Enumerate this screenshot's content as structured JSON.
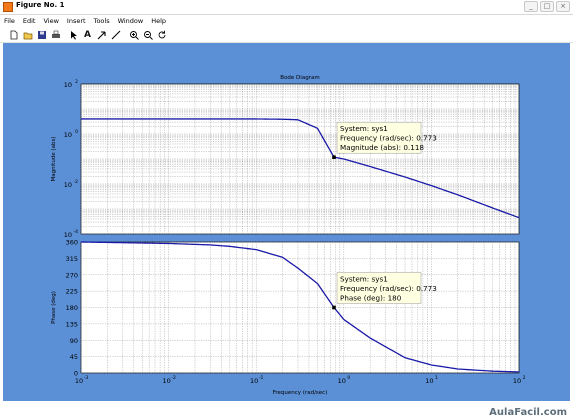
{
  "window": {
    "title": "Figure No. 1",
    "controls": [
      "_",
      "□",
      "×"
    ]
  },
  "menu": [
    "File",
    "Edit",
    "View",
    "Insert",
    "Tools",
    "Window",
    "Help"
  ],
  "toolbar": {
    "icons": [
      "new-file-icon",
      "open-folder-icon",
      "save-icon",
      "print-icon",
      "pointer-icon",
      "text-icon",
      "arrow-icon",
      "line-icon",
      "zoom-in-icon",
      "zoom-out-icon",
      "rotate-icon"
    ],
    "text_tool_label": "A"
  },
  "colors": {
    "figure_bg": "#5b8fd6",
    "axes_bg": "#ffffff",
    "curve": "#1a1aa8",
    "datatip_bg": "#ffffe1"
  },
  "chart_data": {
    "type": "line",
    "title": "Bode Diagram",
    "xlabel": "Frequency  (rad/sec)",
    "xscale": "log",
    "xlim": [
      0.001,
      100
    ],
    "x_tick_labels": [
      "10",
      "10",
      "10",
      "10",
      "10",
      "10"
    ],
    "x_tick_exponents": [
      "-3",
      "-2",
      "-1",
      "0",
      "1",
      "2"
    ],
    "grid": true,
    "series": [
      {
        "name": "sys1",
        "panel": "magnitude",
        "ylabel": "Magnitude (abs)",
        "yscale": "log",
        "ylim": [
          0.0001,
          100
        ],
        "y_tick_labels": [
          "10",
          "10",
          "10",
          "10"
        ],
        "y_tick_exponents": [
          "-4",
          "-2",
          "0",
          "2"
        ],
        "model": "1/(1+s/w)^2, flat magnitude 4 below corner",
        "x": [
          0.001,
          0.01,
          0.1,
          0.2,
          0.3,
          0.5,
          0.773,
          1,
          2,
          5,
          10,
          20,
          50,
          100
        ],
        "values": [
          4,
          4,
          4,
          3.9,
          3.7,
          1.7,
          0.118,
          0.1,
          0.05,
          0.019,
          0.0086,
          0.0037,
          0.0011,
          0.00045
        ]
      },
      {
        "name": "sys1",
        "panel": "phase",
        "ylabel": "Phase (deg)",
        "ylim": [
          0,
          360
        ],
        "y_ticks": [
          0,
          45,
          90,
          135,
          180,
          225,
          270,
          315,
          360
        ],
        "x": [
          0.001,
          0.01,
          0.03,
          0.05,
          0.1,
          0.2,
          0.3,
          0.5,
          0.773,
          1,
          2,
          5,
          10,
          20,
          50,
          100
        ],
        "values": [
          360,
          356,
          352,
          348,
          339,
          318,
          288,
          246,
          180,
          147,
          96,
          42,
          22,
          11,
          5,
          3
        ]
      }
    ],
    "annotations": [
      {
        "panel": "magnitude",
        "lines": [
          "System: sys1",
          "Frequency (rad/sec): 0.773",
          "Magnitude (abs): 0.118"
        ],
        "x": 0.773,
        "y": 0.118
      },
      {
        "panel": "phase",
        "lines": [
          "System: sys1",
          "Frequency (rad/sec): 0.773",
          "Phase (deg): 180"
        ],
        "x": 0.773,
        "y": 180
      }
    ]
  },
  "watermark": "AulaFacil.com"
}
